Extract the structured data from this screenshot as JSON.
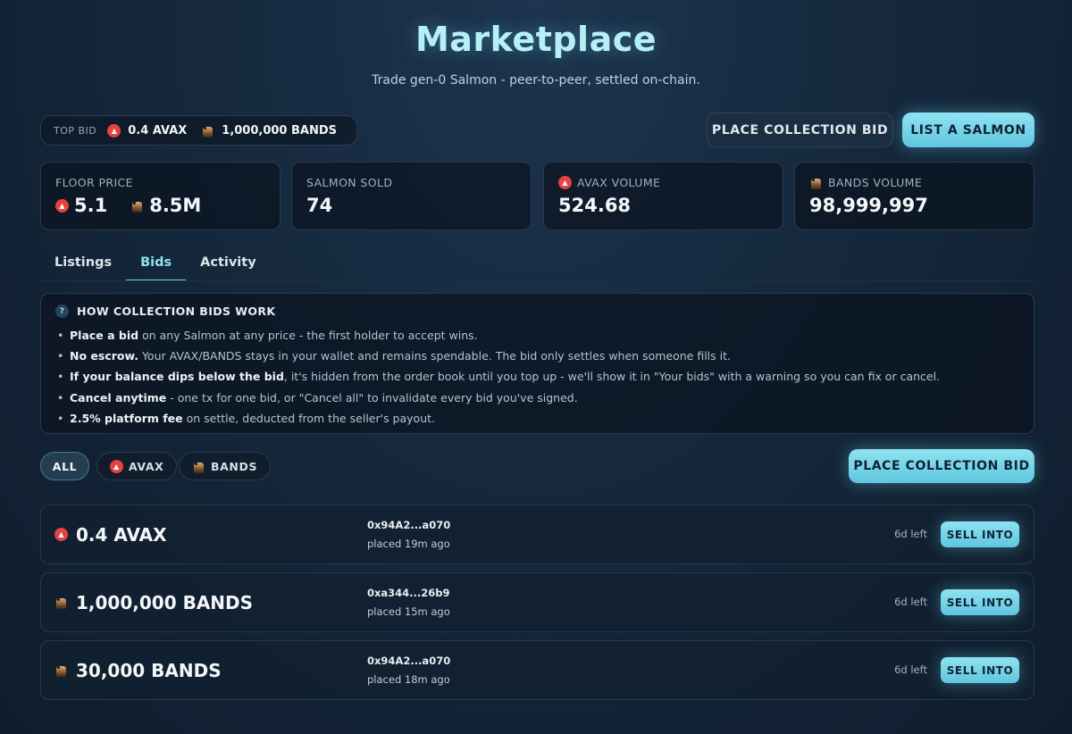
{
  "header": {
    "title": "Marketplace",
    "subtitle": "Trade gen-0 Salmon - peer-to-peer, settled on-chain."
  },
  "top_bid": {
    "label": "TOP BID",
    "avax": "0.4 AVAX",
    "bands": "1,000,000 BANDS"
  },
  "actions": {
    "place_collection_bid": "PLACE COLLECTION BID",
    "list_salmon": "LIST A SALMON"
  },
  "stats": [
    {
      "label": "FLOOR PRICE",
      "avax_value": "5.1",
      "bands_value": "8.5M"
    },
    {
      "label": "SALMON SOLD",
      "value": "74"
    },
    {
      "label": "AVAX VOLUME",
      "value": "524.68"
    },
    {
      "label": "BANDS VOLUME",
      "value": "98,999,997"
    }
  ],
  "tabs": [
    {
      "label": "Listings",
      "active": false
    },
    {
      "label": "Bids",
      "active": true
    },
    {
      "label": "Activity",
      "active": false
    }
  ],
  "info": {
    "title": "HOW COLLECTION BIDS WORK",
    "items": [
      {
        "bold": "Place a bid",
        "text": " on any Salmon at any price - the first holder to accept wins."
      },
      {
        "bold": "No escrow.",
        "text": " Your AVAX/BANDS stays in your wallet and remains spendable. The bid only settles when someone fills it."
      },
      {
        "bold": "If your balance dips below the bid",
        "text": ", it's hidden from the order book until you top up - we'll show it in \"Your bids\" with a warning so you can fix or cancel."
      },
      {
        "bold": "Cancel anytime",
        "text": " - one tx for one bid, or \"Cancel all\" to invalidate every bid you've signed."
      },
      {
        "bold": "2.5% platform fee",
        "text": " on settle, deducted from the seller's payout."
      }
    ]
  },
  "filters": {
    "all": "ALL",
    "avax": "AVAX",
    "bands": "BANDS",
    "active": "ALL"
  },
  "bids": [
    {
      "currency": "AVAX",
      "amount": "0.4 AVAX",
      "address": "0x94A2...a070",
      "placed": "placed 19m ago",
      "time_left": "6d left",
      "action": "SELL INTO"
    },
    {
      "currency": "BANDS",
      "amount": "1,000,000 BANDS",
      "address": "0xa344...26b9",
      "placed": "placed 15m ago",
      "time_left": "6d left",
      "action": "SELL INTO"
    },
    {
      "currency": "BANDS",
      "amount": "30,000 BANDS",
      "address": "0x94A2...a070",
      "placed": "placed 18m ago",
      "time_left": "6d left",
      "action": "SELL INTO"
    }
  ],
  "colors": {
    "accent": "#6fd0e6",
    "avax": "#e84142",
    "background": "#15283d",
    "title": "#b5f0f7"
  },
  "icons": {
    "avax": "avax-logo-icon",
    "bands": "salmon-bands-icon",
    "info": "question-icon"
  }
}
